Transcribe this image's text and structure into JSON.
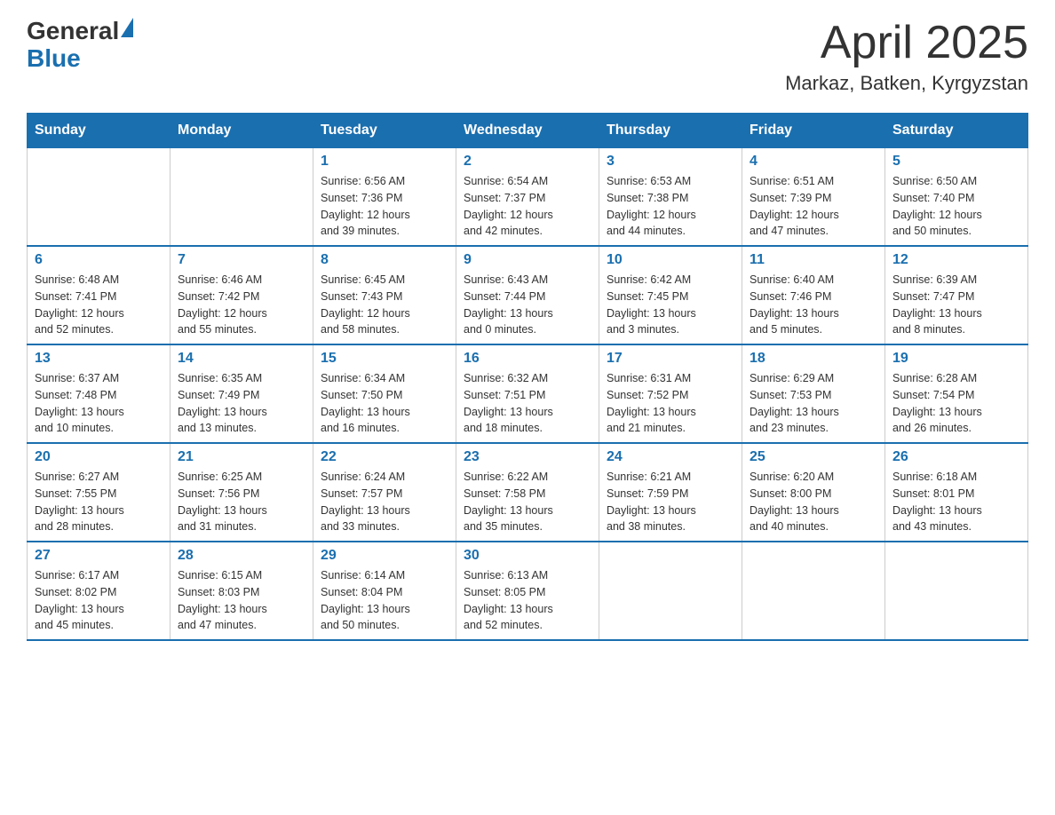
{
  "header": {
    "logo_general": "General",
    "logo_blue": "Blue",
    "month_title": "April 2025",
    "location": "Markaz, Batken, Kyrgyzstan"
  },
  "days_of_week": [
    "Sunday",
    "Monday",
    "Tuesday",
    "Wednesday",
    "Thursday",
    "Friday",
    "Saturday"
  ],
  "weeks": [
    [
      {
        "day": "",
        "info": ""
      },
      {
        "day": "",
        "info": ""
      },
      {
        "day": "1",
        "info": "Sunrise: 6:56 AM\nSunset: 7:36 PM\nDaylight: 12 hours\nand 39 minutes."
      },
      {
        "day": "2",
        "info": "Sunrise: 6:54 AM\nSunset: 7:37 PM\nDaylight: 12 hours\nand 42 minutes."
      },
      {
        "day": "3",
        "info": "Sunrise: 6:53 AM\nSunset: 7:38 PM\nDaylight: 12 hours\nand 44 minutes."
      },
      {
        "day": "4",
        "info": "Sunrise: 6:51 AM\nSunset: 7:39 PM\nDaylight: 12 hours\nand 47 minutes."
      },
      {
        "day": "5",
        "info": "Sunrise: 6:50 AM\nSunset: 7:40 PM\nDaylight: 12 hours\nand 50 minutes."
      }
    ],
    [
      {
        "day": "6",
        "info": "Sunrise: 6:48 AM\nSunset: 7:41 PM\nDaylight: 12 hours\nand 52 minutes."
      },
      {
        "day": "7",
        "info": "Sunrise: 6:46 AM\nSunset: 7:42 PM\nDaylight: 12 hours\nand 55 minutes."
      },
      {
        "day": "8",
        "info": "Sunrise: 6:45 AM\nSunset: 7:43 PM\nDaylight: 12 hours\nand 58 minutes."
      },
      {
        "day": "9",
        "info": "Sunrise: 6:43 AM\nSunset: 7:44 PM\nDaylight: 13 hours\nand 0 minutes."
      },
      {
        "day": "10",
        "info": "Sunrise: 6:42 AM\nSunset: 7:45 PM\nDaylight: 13 hours\nand 3 minutes."
      },
      {
        "day": "11",
        "info": "Sunrise: 6:40 AM\nSunset: 7:46 PM\nDaylight: 13 hours\nand 5 minutes."
      },
      {
        "day": "12",
        "info": "Sunrise: 6:39 AM\nSunset: 7:47 PM\nDaylight: 13 hours\nand 8 minutes."
      }
    ],
    [
      {
        "day": "13",
        "info": "Sunrise: 6:37 AM\nSunset: 7:48 PM\nDaylight: 13 hours\nand 10 minutes."
      },
      {
        "day": "14",
        "info": "Sunrise: 6:35 AM\nSunset: 7:49 PM\nDaylight: 13 hours\nand 13 minutes."
      },
      {
        "day": "15",
        "info": "Sunrise: 6:34 AM\nSunset: 7:50 PM\nDaylight: 13 hours\nand 16 minutes."
      },
      {
        "day": "16",
        "info": "Sunrise: 6:32 AM\nSunset: 7:51 PM\nDaylight: 13 hours\nand 18 minutes."
      },
      {
        "day": "17",
        "info": "Sunrise: 6:31 AM\nSunset: 7:52 PM\nDaylight: 13 hours\nand 21 minutes."
      },
      {
        "day": "18",
        "info": "Sunrise: 6:29 AM\nSunset: 7:53 PM\nDaylight: 13 hours\nand 23 minutes."
      },
      {
        "day": "19",
        "info": "Sunrise: 6:28 AM\nSunset: 7:54 PM\nDaylight: 13 hours\nand 26 minutes."
      }
    ],
    [
      {
        "day": "20",
        "info": "Sunrise: 6:27 AM\nSunset: 7:55 PM\nDaylight: 13 hours\nand 28 minutes."
      },
      {
        "day": "21",
        "info": "Sunrise: 6:25 AM\nSunset: 7:56 PM\nDaylight: 13 hours\nand 31 minutes."
      },
      {
        "day": "22",
        "info": "Sunrise: 6:24 AM\nSunset: 7:57 PM\nDaylight: 13 hours\nand 33 minutes."
      },
      {
        "day": "23",
        "info": "Sunrise: 6:22 AM\nSunset: 7:58 PM\nDaylight: 13 hours\nand 35 minutes."
      },
      {
        "day": "24",
        "info": "Sunrise: 6:21 AM\nSunset: 7:59 PM\nDaylight: 13 hours\nand 38 minutes."
      },
      {
        "day": "25",
        "info": "Sunrise: 6:20 AM\nSunset: 8:00 PM\nDaylight: 13 hours\nand 40 minutes."
      },
      {
        "day": "26",
        "info": "Sunrise: 6:18 AM\nSunset: 8:01 PM\nDaylight: 13 hours\nand 43 minutes."
      }
    ],
    [
      {
        "day": "27",
        "info": "Sunrise: 6:17 AM\nSunset: 8:02 PM\nDaylight: 13 hours\nand 45 minutes."
      },
      {
        "day": "28",
        "info": "Sunrise: 6:15 AM\nSunset: 8:03 PM\nDaylight: 13 hours\nand 47 minutes."
      },
      {
        "day": "29",
        "info": "Sunrise: 6:14 AM\nSunset: 8:04 PM\nDaylight: 13 hours\nand 50 minutes."
      },
      {
        "day": "30",
        "info": "Sunrise: 6:13 AM\nSunset: 8:05 PM\nDaylight: 13 hours\nand 52 minutes."
      },
      {
        "day": "",
        "info": ""
      },
      {
        "day": "",
        "info": ""
      },
      {
        "day": "",
        "info": ""
      }
    ]
  ]
}
